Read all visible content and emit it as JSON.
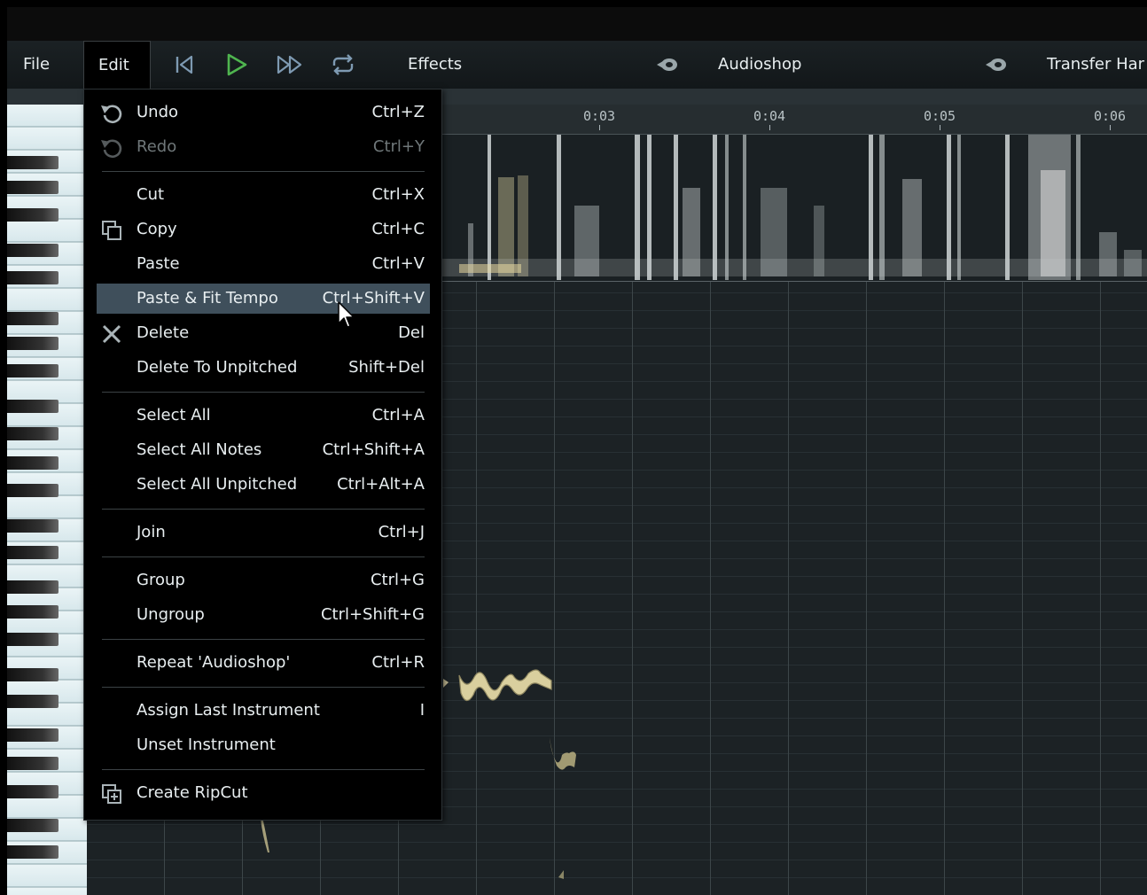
{
  "menubar": {
    "file": "File",
    "edit": "Edit",
    "effects": "Effects",
    "plugin1": "Audioshop",
    "plugin2": "Transfer Har"
  },
  "transport": [
    "skip-back-icon",
    "play-icon",
    "fast-forward-icon",
    "loop-icon"
  ],
  "ruler": {
    "ticks": [
      "0:03",
      "0:04",
      "0:05",
      "0:06"
    ]
  },
  "edit_menu": {
    "items": [
      {
        "label": "Undo",
        "shortcut": "Ctrl+Z",
        "icon": "undo-icon",
        "enabled": true
      },
      {
        "label": "Redo",
        "shortcut": "Ctrl+Y",
        "icon": "redo-icon",
        "enabled": false
      },
      {
        "label": "Cut",
        "shortcut": "Ctrl+X"
      },
      {
        "label": "Copy",
        "shortcut": "Ctrl+C",
        "icon": "copy-icon"
      },
      {
        "label": "Paste",
        "shortcut": "Ctrl+V"
      },
      {
        "label": "Paste & Fit Tempo",
        "shortcut": "Ctrl+Shift+V",
        "highlighted": true
      },
      {
        "label": "Delete",
        "shortcut": "Del",
        "icon": "delete-x-icon"
      },
      {
        "label": "Delete To Unpitched",
        "shortcut": "Shift+Del"
      },
      {
        "label": "Select All",
        "shortcut": "Ctrl+A"
      },
      {
        "label": "Select All Notes",
        "shortcut": "Ctrl+Shift+A"
      },
      {
        "label": "Select All Unpitched",
        "shortcut": "Ctrl+Alt+A"
      },
      {
        "label": "Join",
        "shortcut": "Ctrl+J"
      },
      {
        "label": "Group",
        "shortcut": "Ctrl+G"
      },
      {
        "label": "Ungroup",
        "shortcut": "Ctrl+Shift+G"
      },
      {
        "label": "Repeat 'Audioshop'",
        "shortcut": "Ctrl+R"
      },
      {
        "label": "Assign Last Instrument",
        "shortcut": "I"
      },
      {
        "label": "Unset Instrument",
        "shortcut": ""
      },
      {
        "label": "Create RipCut",
        "shortcut": "",
        "icon": "ripcut-icon"
      }
    ]
  },
  "colors": {
    "accent_play": "#4fb54f",
    "transport": "#7e9ab2",
    "highlight": "#3f4f5b"
  }
}
